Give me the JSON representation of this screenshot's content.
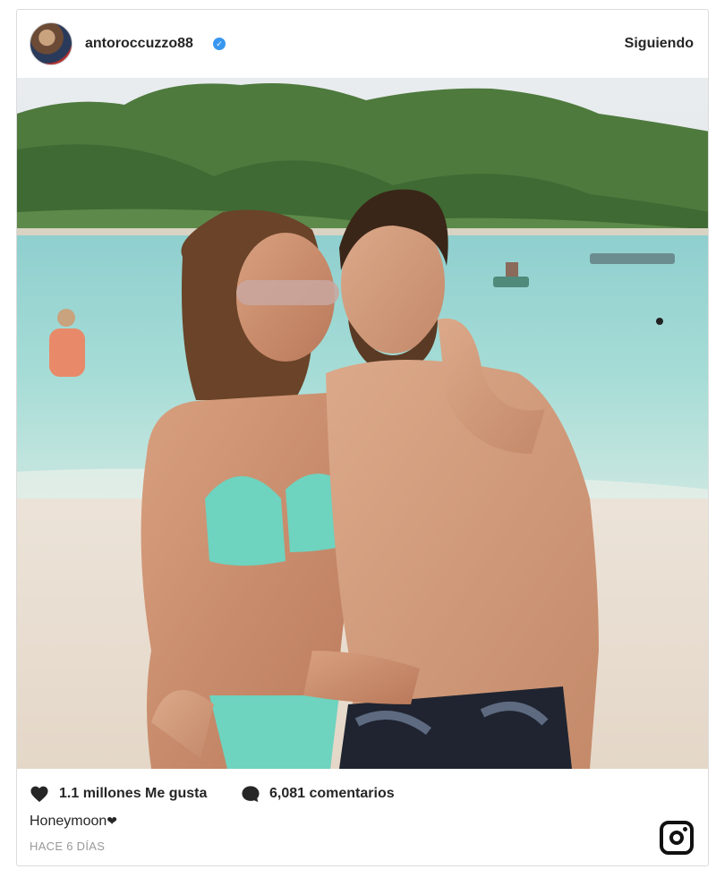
{
  "post": {
    "username": "antoroccuzzo88",
    "verified": true,
    "follow_status": "Siguiendo",
    "likes_text": "1.1 millones Me gusta",
    "comments_text": "6,081 comentarios",
    "caption_text": "Honeymoon",
    "caption_emoji": "❤",
    "timestamp": "HACE 6 DÍAS"
  },
  "icons": {
    "verified": "verified-badge-icon",
    "like": "heart-icon",
    "comment": "comment-bubble-icon",
    "brand": "instagram-logo-icon"
  },
  "colors": {
    "verified_blue": "#3897f0",
    "text": "#262626",
    "muted": "#999999",
    "border": "#dbdbdb"
  }
}
